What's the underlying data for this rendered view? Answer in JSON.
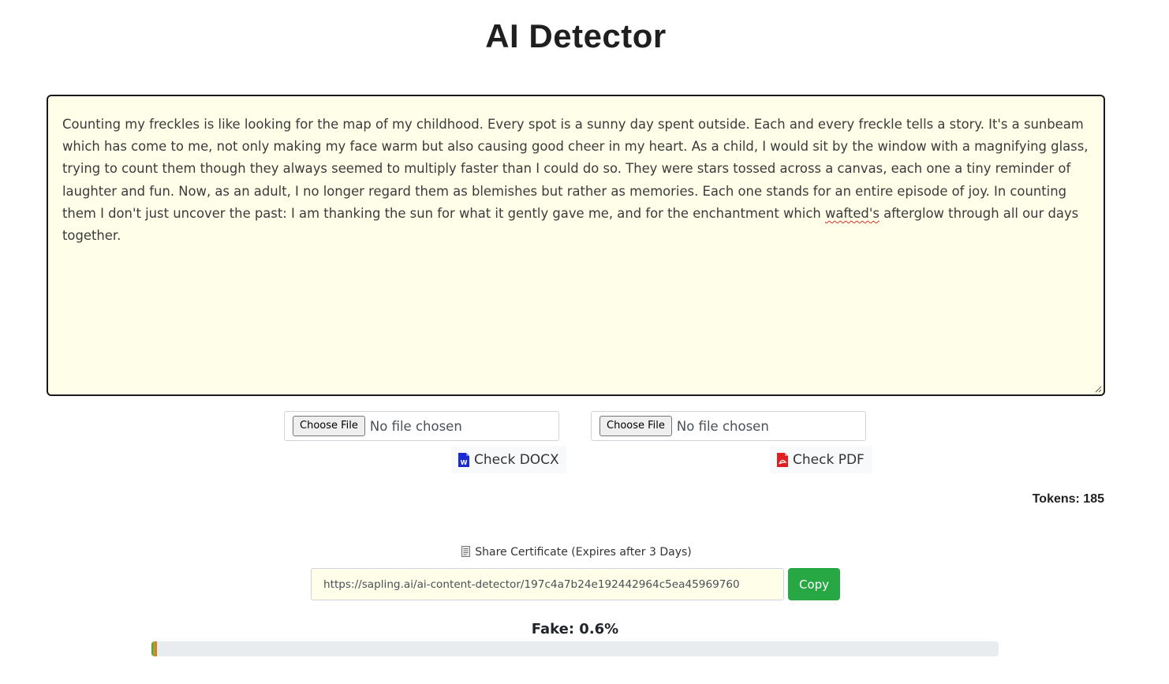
{
  "header": {
    "title": "AI Detector"
  },
  "editor": {
    "text_before": "Counting my freckles is like looking for the map of my childhood. Every spot is a sunny day spent outside. Each and every freckle tells a story. It's a sunbeam which has come to me, not only making my face warm but also causing good cheer in my heart. As a child, I would sit by the window with a magnifying glass, trying to count them though they always seemed to multiply faster than I could do so. They were stars tossed across a canvas, each one a tiny reminder of laughter and fun. Now, as an adult, I no longer regard them as blemishes but rather as memories. Each one stands for an entire episode of joy. In counting them I don't just uncover the past: I am thanking the sun for what it gently gave me, and for the enchantment which ",
    "misspelled_word": "wafted's",
    "text_after": " afterglow through all our days together."
  },
  "uploads": {
    "docx": {
      "choose_label": "Choose File",
      "status": "No file chosen",
      "check_label": "Check DOCX",
      "icon": "word-file-icon",
      "icon_color": "#1a2bd6"
    },
    "pdf": {
      "choose_label": "Choose File",
      "status": "No file chosen",
      "check_label": "Check PDF",
      "icon": "pdf-file-icon",
      "icon_color": "#e02020"
    }
  },
  "tokens": {
    "label": "Tokens: 185"
  },
  "share": {
    "label": "Share Certificate (Expires after 3 Days)",
    "icon": "certificate-icon",
    "url": "https://sapling.ai/ai-content-detector/197c4a7b24e192442964c5ea45969760",
    "copy_label": "Copy",
    "copy_color": "#28a745"
  },
  "result": {
    "label": "Fake: 0.6%",
    "fake_percent": 0.6
  }
}
